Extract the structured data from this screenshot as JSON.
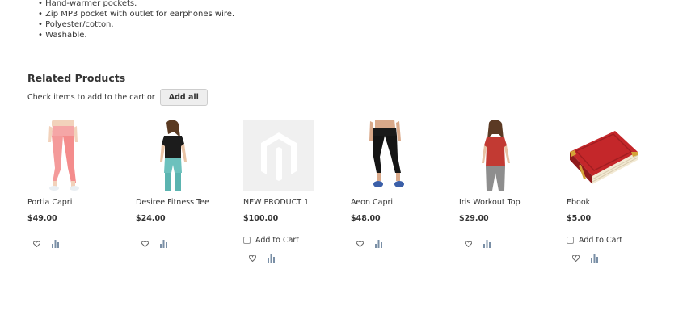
{
  "features": [
    "Hand-warmer pockets.",
    "Zip MP3 pocket with outlet for earphones wire.",
    "Polyester/cotton.",
    "Washable."
  ],
  "related": {
    "title": "Related Products",
    "check_text": "Check items to add to the cart or",
    "add_all_label": "Add all"
  },
  "products": [
    {
      "name": "Portia Capri",
      "price": "$49.00",
      "image": "pink-capri-model"
    },
    {
      "name": "Desiree Fitness Tee",
      "price": "$24.00",
      "image": "black-tee-model"
    },
    {
      "name": "NEW PRODUCT 1",
      "price": "$100.00",
      "image": "placeholder-logo",
      "add_to_cart": "Add to Cart"
    },
    {
      "name": "Aeon Capri",
      "price": "$48.00",
      "image": "black-capri-legs"
    },
    {
      "name": "Iris Workout Top",
      "price": "$29.00",
      "image": "red-top-model"
    },
    {
      "name": "Ebook",
      "price": "$5.00",
      "image": "red-book",
      "add_to_cart": "Add to Cart"
    }
  ],
  "icons": {
    "wishlist": "heart-icon",
    "compare": "compare-bars-icon"
  },
  "colors": {
    "icon": "#666666",
    "price_text": "#333333"
  }
}
